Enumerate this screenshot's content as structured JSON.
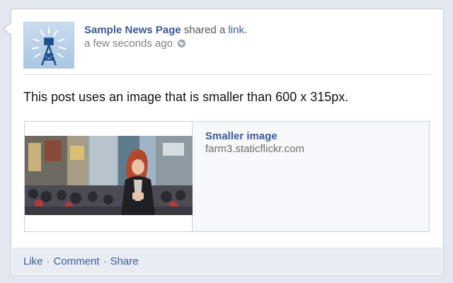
{
  "post": {
    "page_name": "Sample News Page",
    "shared_verb": "shared a",
    "shared_object": "link.",
    "timestamp": "a few seconds ago",
    "privacy_icon": "globe-icon",
    "text": "This post uses an image that is smaller than 600 x 315px."
  },
  "link_preview": {
    "title": "Smaller image",
    "domain": "farm3.staticflickr.com"
  },
  "actions": {
    "like": "Like",
    "comment": "Comment",
    "share": "Share",
    "separator": "·"
  },
  "colors": {
    "link_blue": "#3b5998",
    "footer_bg": "#e9ecf3",
    "page_bg": "#e3e7f0"
  }
}
